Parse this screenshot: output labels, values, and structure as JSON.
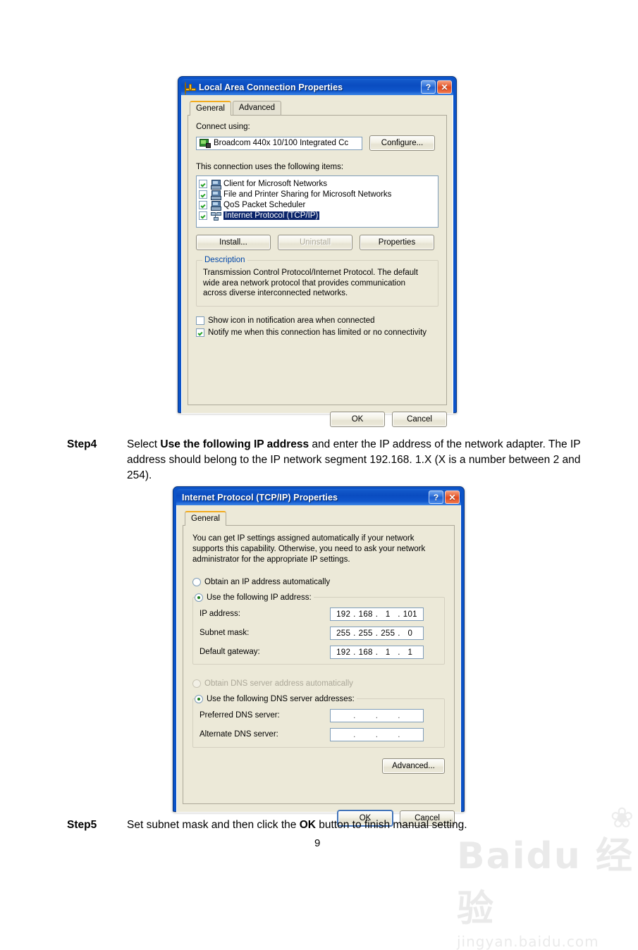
{
  "page": {
    "number": "9",
    "background": "#ffffff"
  },
  "watermark": {
    "brand": "Baidu 经验",
    "url": "jingyan.baidu.com"
  },
  "dialog1": {
    "title": "Local Area Connection Properties",
    "title_icon": "network-connection-icon",
    "help_button": "?",
    "close_button": "✕",
    "tabs": [
      {
        "label": "General",
        "active": true
      },
      {
        "label": "Advanced",
        "active": false
      }
    ],
    "connect_using_label": "Connect using:",
    "adapter": {
      "name": "Broadcom 440x 10/100 Integrated Cc",
      "icon": "network-adapter-icon"
    },
    "configure_button": "Configure...",
    "items_label": "This connection uses the following items:",
    "items": [
      {
        "label": "Client for Microsoft Networks",
        "checked": true,
        "selected": false,
        "icon": "computer-icon"
      },
      {
        "label": "File and Printer Sharing for Microsoft Networks",
        "checked": true,
        "selected": false,
        "icon": "computer-icon"
      },
      {
        "label": "QoS Packet Scheduler",
        "checked": true,
        "selected": false,
        "icon": "computer-icon"
      },
      {
        "label": "Internet Protocol (TCP/IP)",
        "checked": true,
        "selected": true,
        "icon": "protocol-icon"
      }
    ],
    "install_button": "Install...",
    "uninstall_button": "Uninstall",
    "uninstall_disabled": true,
    "properties_button": "Properties",
    "description_legend": "Description",
    "description_text": "Transmission Control Protocol/Internet Protocol. The default wide area network protocol that provides communication across diverse interconnected networks.",
    "checkboxes": [
      {
        "label": "Show icon in notification area when connected",
        "checked": false
      },
      {
        "label": "Notify me when this connection has limited or no connectivity",
        "checked": true
      }
    ],
    "ok_button": "OK",
    "cancel_button": "Cancel"
  },
  "step4": {
    "label": "Step4",
    "text_part1": "Select ",
    "bold1": "Use the following IP address",
    "text_part2": " and enter the IP address of the network adapter. The IP address should belong to the IP network segment 192.168. 1.X (X is a number between 2 and 254)."
  },
  "dialog2": {
    "title": "Internet Protocol (TCP/IP) Properties",
    "help_button": "?",
    "close_button": "✕",
    "tabs": [
      {
        "label": "General",
        "active": true
      }
    ],
    "intro_text": "You can get IP settings assigned automatically if your network supports this capability. Otherwise, you need to ask your network administrator for the appropriate IP settings.",
    "radio_auto_ip": {
      "label": "Obtain an IP address automatically",
      "selected": false,
      "disabled": false
    },
    "radio_manual_ip": {
      "label": "Use the following IP address:",
      "selected": true,
      "disabled": false
    },
    "ip_fields": [
      {
        "label": "IP address:",
        "octets": [
          "192",
          "168",
          "1",
          "101"
        ]
      },
      {
        "label": "Subnet mask:",
        "octets": [
          "255",
          "255",
          "255",
          "0"
        ]
      },
      {
        "label": "Default gateway:",
        "octets": [
          "192",
          "168",
          "1",
          "1"
        ]
      }
    ],
    "radio_auto_dns": {
      "label": "Obtain DNS server address automatically",
      "selected": false,
      "disabled": true
    },
    "radio_manual_dns": {
      "label": "Use the following DNS server addresses:",
      "selected": true,
      "disabled": false
    },
    "dns_fields": [
      {
        "label": "Preferred DNS server:",
        "octets": [
          "",
          "",
          "",
          ""
        ]
      },
      {
        "label": "Alternate DNS server:",
        "octets": [
          "",
          "",
          "",
          ""
        ]
      }
    ],
    "advanced_button": "Advanced...",
    "ok_button": "OK",
    "cancel_button": "Cancel"
  },
  "step5": {
    "label": "Step5",
    "text_part1": "Set subnet mask and then click the ",
    "bold1": "OK",
    "text_part2": " button to finish manual setting."
  }
}
